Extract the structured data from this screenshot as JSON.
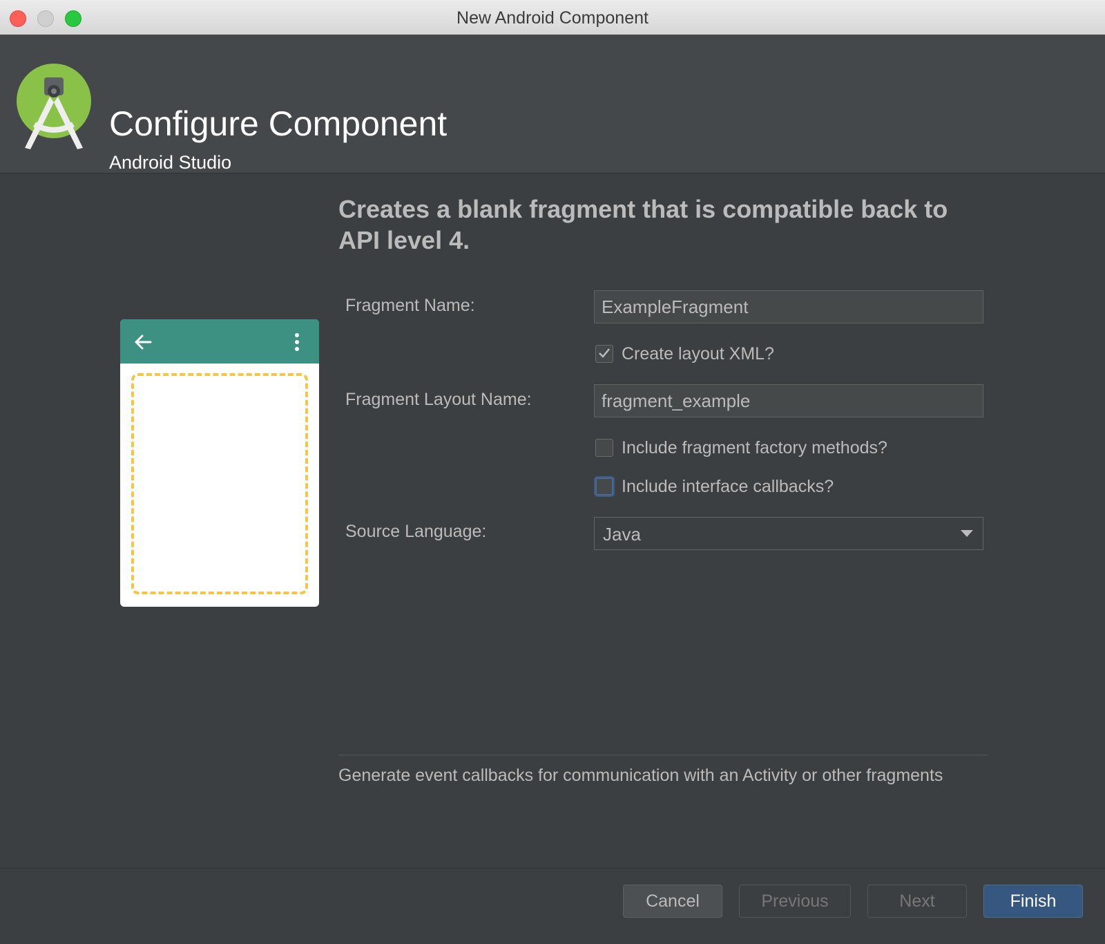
{
  "window": {
    "title": "New Android Component"
  },
  "header": {
    "title": "Configure Component",
    "subtitle": "Android Studio"
  },
  "description": "Creates a blank fragment that is compatible back to API level 4.",
  "form": {
    "fragment_name": {
      "label": "Fragment Name:",
      "value": "ExampleFragment"
    },
    "create_layout_xml": {
      "label": "Create layout XML?",
      "checked": true
    },
    "fragment_layout_name": {
      "label": "Fragment Layout Name:",
      "value": "fragment_example"
    },
    "include_factory_methods": {
      "label": "Include fragment factory methods?",
      "checked": false
    },
    "include_interface_callbacks": {
      "label": "Include interface callbacks?",
      "checked": false
    },
    "source_language": {
      "label": "Source Language:",
      "value": "Java"
    }
  },
  "help_text": "Generate event callbacks for communication with an Activity or other fragments",
  "buttons": {
    "cancel": "Cancel",
    "previous": "Previous",
    "next": "Next",
    "finish": "Finish"
  },
  "colors": {
    "accent": "#365880",
    "phone_bar": "#3c9183",
    "phone_frame": "#f6c543",
    "logo_green": "#8ac148"
  }
}
